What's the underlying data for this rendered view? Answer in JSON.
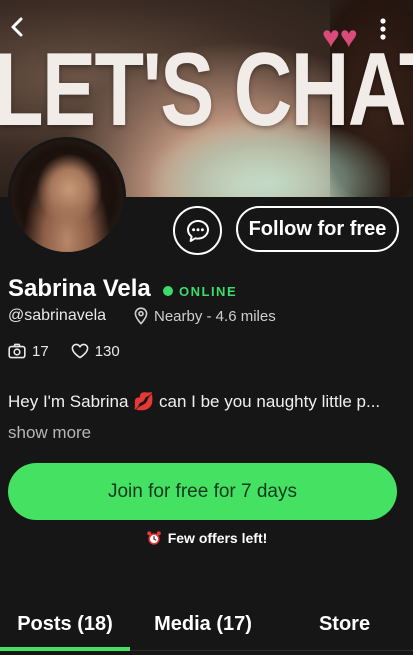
{
  "banner": {
    "headline": "LET'S CHAT...",
    "back_icon": "chevron-left-icon",
    "menu_icon": "kebab-menu-icon",
    "hearts": "♥♥"
  },
  "profile": {
    "name": "Sabrina Vela",
    "status": "ONLINE",
    "handle": "@sabrinavela",
    "location": "Nearby - 4.6 miles",
    "photos_count": "17",
    "likes_count": "130",
    "bio": "Hey I'm Sabrina 💋 can I be you naughty little p...",
    "show_more": "show more"
  },
  "actions": {
    "message_icon": "chat-bubble-icon",
    "follow_label": "Follow for free",
    "join_label": "Join for free for 7 days",
    "offers_label": "Few offers left!"
  },
  "tabs": [
    {
      "label": "Posts (18)",
      "active": true
    },
    {
      "label": "Media (17)",
      "active": false
    },
    {
      "label": "Store",
      "active": false
    }
  ],
  "colors": {
    "accent": "#44e163",
    "online": "#3ddc6a",
    "background": "#161616"
  }
}
